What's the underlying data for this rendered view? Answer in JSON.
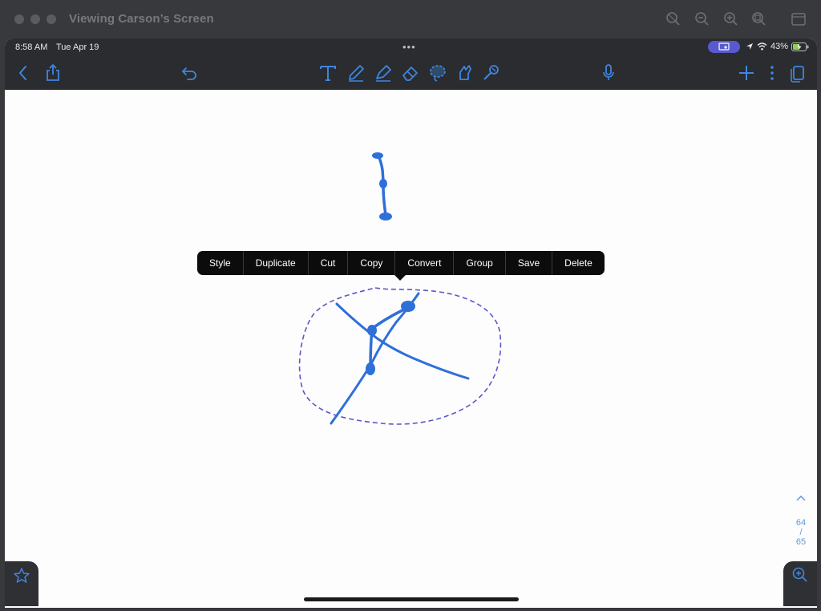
{
  "window": {
    "title": "Viewing Carson’s Screen"
  },
  "status_bar": {
    "time": "8:58 AM",
    "date": "Tue Apr 19",
    "battery": "43%"
  },
  "toolbar": {
    "left": [
      "back-icon",
      "share-icon",
      "undo-icon"
    ],
    "tools": [
      "text-tool-icon",
      "pen-tool-icon",
      "highlighter-tool-icon",
      "eraser-tool-icon",
      "lasso-tool-icon",
      "shapes-tool-icon",
      "laser-pointer-icon"
    ],
    "right": [
      "microphone-icon",
      "add-icon",
      "more-icon",
      "pages-icon"
    ]
  },
  "context_menu": {
    "items": [
      "Style",
      "Duplicate",
      "Cut",
      "Copy",
      "Convert",
      "Group",
      "Save",
      "Delete"
    ]
  },
  "page_nav": {
    "current": "64",
    "separator": "/",
    "total": "65"
  },
  "colors": {
    "ink": "#2f6fd9",
    "lasso": "#5a57c9",
    "accent": "#3f86e0",
    "cast_pill": "#5a59d0"
  }
}
